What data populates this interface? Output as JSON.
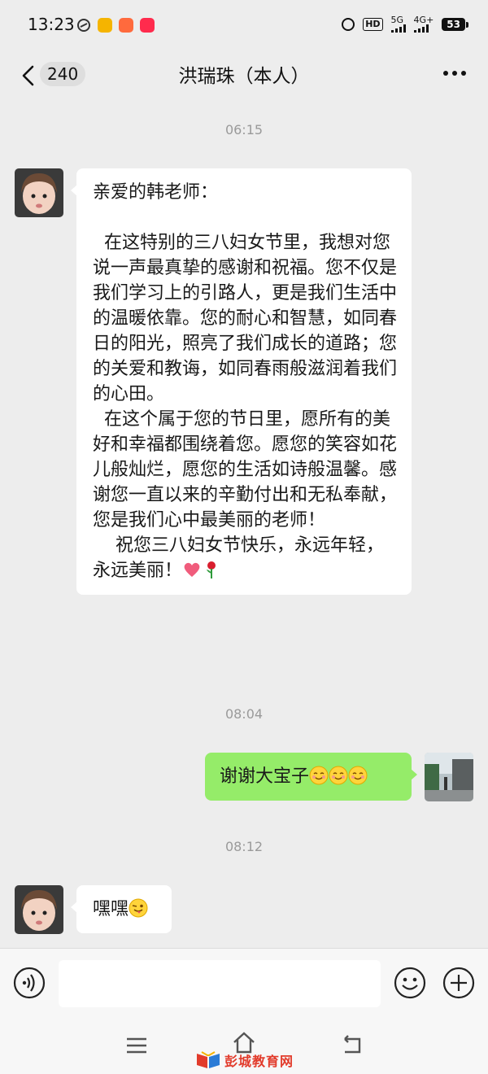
{
  "status_bar": {
    "time": "13:23",
    "hd_label": "HD",
    "net_5g": "5G",
    "net_4g": "4G+",
    "battery": "53"
  },
  "header": {
    "unread_count": "240",
    "title": "洪瑞珠（本人）"
  },
  "messages": [
    {
      "timestamp": "06:15"
    },
    {
      "side": "left",
      "text": "亲爱的韩老师：\n\n  在这特别的三八妇女节里，我想对您说一声最真挚的感谢和祝福。您不仅是我们学习上的引路人，更是我们生活中的温暖依靠。您的耐心和智慧，如同春日的阳光，照亮了我们成长的道路；您的关爱和教诲，如同春雨般滋润着我们的心田。\n  在这个属于您的节日里，愿所有的美好和幸福都围绕着您。愿您的笑容如花儿般灿烂，愿您的生活如诗般温馨。感谢您一直以来的辛勤付出和无私奉献，您是我们心中最美丽的老师！\n    祝您三八妇女节快乐，永远年轻，永远美丽！",
      "emojis": [
        "heart",
        "rose"
      ]
    },
    {
      "timestamp": "08:04"
    },
    {
      "side": "right",
      "text": "谢谢大宝子",
      "emojis": [
        "smile",
        "smile",
        "smile"
      ]
    },
    {
      "timestamp": "08:12"
    },
    {
      "side": "left",
      "text": "嘿嘿",
      "emojis": [
        "wink-tongue"
      ]
    }
  ],
  "input": {
    "placeholder": ""
  },
  "watermark": {
    "text": "彭城教育网"
  },
  "colors": {
    "background": "#ededed",
    "bubble_self": "#95ec69",
    "bubble_other": "#ffffff",
    "timestamp": "#9a9a9a"
  }
}
